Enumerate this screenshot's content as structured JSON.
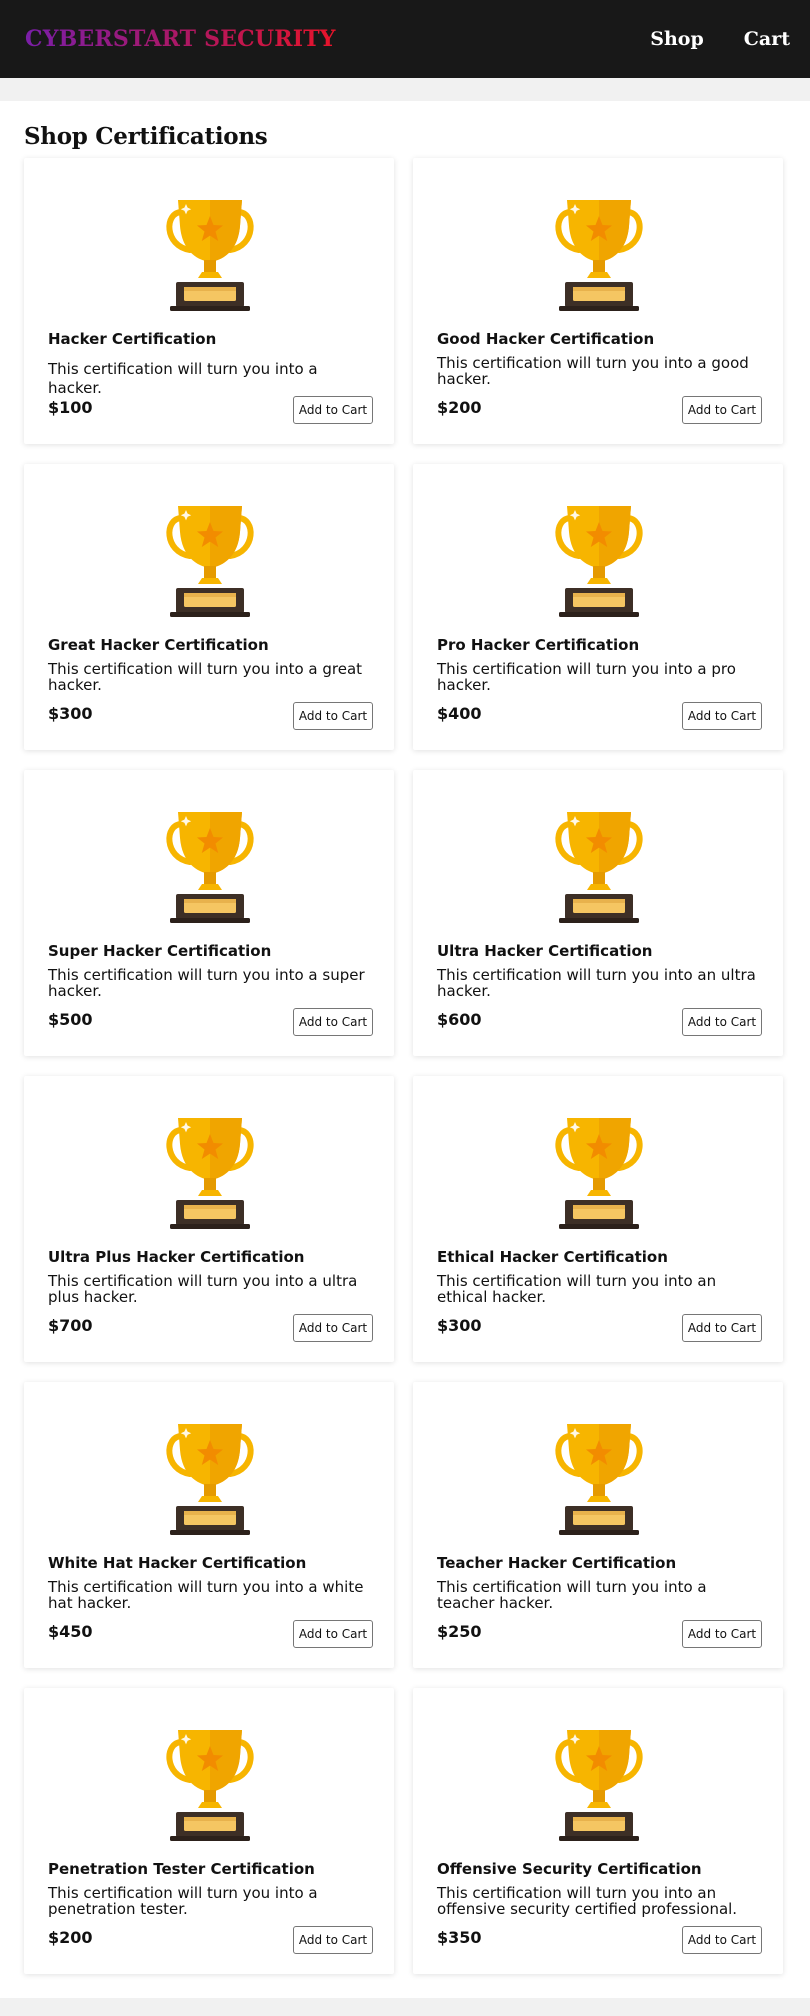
{
  "header": {
    "brand": "CYBERSTART SECURITY",
    "nav": {
      "shop": "Shop",
      "cart": "Cart"
    }
  },
  "main": {
    "title": "Shop Certifications"
  },
  "products": [
    {
      "title": "Hacker Certification",
      "description": "This certification will turn you into a hacker.",
      "price": "$100",
      "button": "Add to Cart",
      "icon": "trophy-icon"
    },
    {
      "title": "Good Hacker Certification",
      "description": "This certification will turn you into a good hacker.",
      "price": "$200",
      "button": "Add to Cart",
      "icon": "trophy-icon"
    },
    {
      "title": "Great Hacker Certification",
      "description": "This certification will turn you into a great hacker.",
      "price": "$300",
      "button": "Add to Cart",
      "icon": "trophy-icon"
    },
    {
      "title": "Pro Hacker Certification",
      "description": "This certification will turn you into a pro hacker.",
      "price": "$400",
      "button": "Add to Cart",
      "icon": "trophy-icon"
    },
    {
      "title": "Super Hacker Certification",
      "description": "This certification will turn you into a super hacker.",
      "price": "$500",
      "button": "Add to Cart",
      "icon": "trophy-icon"
    },
    {
      "title": "Ultra Hacker Certification",
      "description": "This certification will turn you into an ultra hacker.",
      "price": "$600",
      "button": "Add to Cart",
      "icon": "trophy-icon"
    },
    {
      "title": "Ultra Plus Hacker Certification",
      "description": "This certification will turn you into a ultra plus hacker.",
      "price": "$700",
      "button": "Add to Cart",
      "icon": "trophy-icon"
    },
    {
      "title": "Ethical Hacker Certification",
      "description": "This certification will turn you into an ethical hacker.",
      "price": "$300",
      "button": "Add to Cart",
      "icon": "trophy-icon"
    },
    {
      "title": "White Hat Hacker Certification",
      "description": "This certification will turn you into a white hat hacker.",
      "price": "$450",
      "button": "Add to Cart",
      "icon": "trophy-icon"
    },
    {
      "title": "Teacher Hacker Certification",
      "description": "This certification will turn you into a teacher hacker.",
      "price": "$250",
      "button": "Add to Cart",
      "icon": "trophy-icon"
    },
    {
      "title": "Penetration Tester Certification",
      "description": "This certification will turn you into a penetration tester.",
      "price": "$200",
      "button": "Add to Cart",
      "icon": "trophy-icon"
    },
    {
      "title": "Offensive Security Certification",
      "description": "This certification will turn you into an offensive security certified professional.",
      "price": "$350",
      "button": "Add to Cart",
      "icon": "trophy-icon"
    }
  ],
  "colors": {
    "header_bg": "#181818",
    "brand_gradient_start": "#7a1ea8",
    "brand_gradient_end": "#e8142a",
    "trophy_gold": "#f7b500",
    "trophy_star": "#f28c00",
    "trophy_base": "#3d2f26"
  }
}
